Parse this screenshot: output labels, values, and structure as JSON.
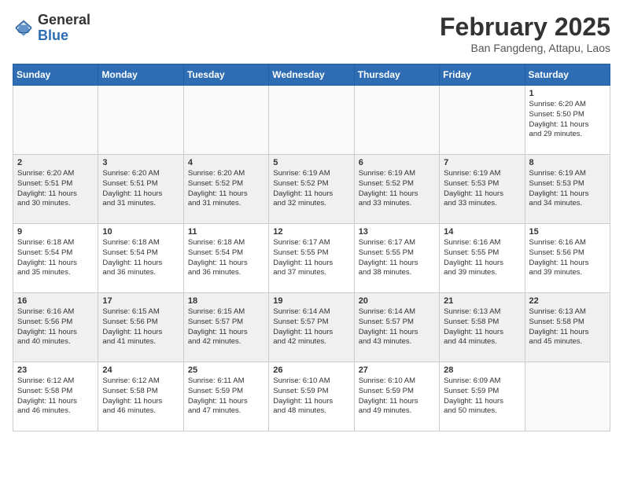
{
  "header": {
    "logo_general": "General",
    "logo_blue": "Blue",
    "month_year": "February 2025",
    "location": "Ban Fangdeng, Attapu, Laos"
  },
  "days_of_week": [
    "Sunday",
    "Monday",
    "Tuesday",
    "Wednesday",
    "Thursday",
    "Friday",
    "Saturday"
  ],
  "weeks": [
    [
      {
        "day": "",
        "info": ""
      },
      {
        "day": "",
        "info": ""
      },
      {
        "day": "",
        "info": ""
      },
      {
        "day": "",
        "info": ""
      },
      {
        "day": "",
        "info": ""
      },
      {
        "day": "",
        "info": ""
      },
      {
        "day": "1",
        "info": "Sunrise: 6:20 AM\nSunset: 5:50 PM\nDaylight: 11 hours\nand 29 minutes."
      }
    ],
    [
      {
        "day": "2",
        "info": "Sunrise: 6:20 AM\nSunset: 5:51 PM\nDaylight: 11 hours\nand 30 minutes."
      },
      {
        "day": "3",
        "info": "Sunrise: 6:20 AM\nSunset: 5:51 PM\nDaylight: 11 hours\nand 31 minutes."
      },
      {
        "day": "4",
        "info": "Sunrise: 6:20 AM\nSunset: 5:52 PM\nDaylight: 11 hours\nand 31 minutes."
      },
      {
        "day": "5",
        "info": "Sunrise: 6:19 AM\nSunset: 5:52 PM\nDaylight: 11 hours\nand 32 minutes."
      },
      {
        "day": "6",
        "info": "Sunrise: 6:19 AM\nSunset: 5:52 PM\nDaylight: 11 hours\nand 33 minutes."
      },
      {
        "day": "7",
        "info": "Sunrise: 6:19 AM\nSunset: 5:53 PM\nDaylight: 11 hours\nand 33 minutes."
      },
      {
        "day": "8",
        "info": "Sunrise: 6:19 AM\nSunset: 5:53 PM\nDaylight: 11 hours\nand 34 minutes."
      }
    ],
    [
      {
        "day": "9",
        "info": "Sunrise: 6:18 AM\nSunset: 5:54 PM\nDaylight: 11 hours\nand 35 minutes."
      },
      {
        "day": "10",
        "info": "Sunrise: 6:18 AM\nSunset: 5:54 PM\nDaylight: 11 hours\nand 36 minutes."
      },
      {
        "day": "11",
        "info": "Sunrise: 6:18 AM\nSunset: 5:54 PM\nDaylight: 11 hours\nand 36 minutes."
      },
      {
        "day": "12",
        "info": "Sunrise: 6:17 AM\nSunset: 5:55 PM\nDaylight: 11 hours\nand 37 minutes."
      },
      {
        "day": "13",
        "info": "Sunrise: 6:17 AM\nSunset: 5:55 PM\nDaylight: 11 hours\nand 38 minutes."
      },
      {
        "day": "14",
        "info": "Sunrise: 6:16 AM\nSunset: 5:55 PM\nDaylight: 11 hours\nand 39 minutes."
      },
      {
        "day": "15",
        "info": "Sunrise: 6:16 AM\nSunset: 5:56 PM\nDaylight: 11 hours\nand 39 minutes."
      }
    ],
    [
      {
        "day": "16",
        "info": "Sunrise: 6:16 AM\nSunset: 5:56 PM\nDaylight: 11 hours\nand 40 minutes."
      },
      {
        "day": "17",
        "info": "Sunrise: 6:15 AM\nSunset: 5:56 PM\nDaylight: 11 hours\nand 41 minutes."
      },
      {
        "day": "18",
        "info": "Sunrise: 6:15 AM\nSunset: 5:57 PM\nDaylight: 11 hours\nand 42 minutes."
      },
      {
        "day": "19",
        "info": "Sunrise: 6:14 AM\nSunset: 5:57 PM\nDaylight: 11 hours\nand 42 minutes."
      },
      {
        "day": "20",
        "info": "Sunrise: 6:14 AM\nSunset: 5:57 PM\nDaylight: 11 hours\nand 43 minutes."
      },
      {
        "day": "21",
        "info": "Sunrise: 6:13 AM\nSunset: 5:58 PM\nDaylight: 11 hours\nand 44 minutes."
      },
      {
        "day": "22",
        "info": "Sunrise: 6:13 AM\nSunset: 5:58 PM\nDaylight: 11 hours\nand 45 minutes."
      }
    ],
    [
      {
        "day": "23",
        "info": "Sunrise: 6:12 AM\nSunset: 5:58 PM\nDaylight: 11 hours\nand 46 minutes."
      },
      {
        "day": "24",
        "info": "Sunrise: 6:12 AM\nSunset: 5:58 PM\nDaylight: 11 hours\nand 46 minutes."
      },
      {
        "day": "25",
        "info": "Sunrise: 6:11 AM\nSunset: 5:59 PM\nDaylight: 11 hours\nand 47 minutes."
      },
      {
        "day": "26",
        "info": "Sunrise: 6:10 AM\nSunset: 5:59 PM\nDaylight: 11 hours\nand 48 minutes."
      },
      {
        "day": "27",
        "info": "Sunrise: 6:10 AM\nSunset: 5:59 PM\nDaylight: 11 hours\nand 49 minutes."
      },
      {
        "day": "28",
        "info": "Sunrise: 6:09 AM\nSunset: 5:59 PM\nDaylight: 11 hours\nand 50 minutes."
      },
      {
        "day": "",
        "info": ""
      }
    ]
  ]
}
